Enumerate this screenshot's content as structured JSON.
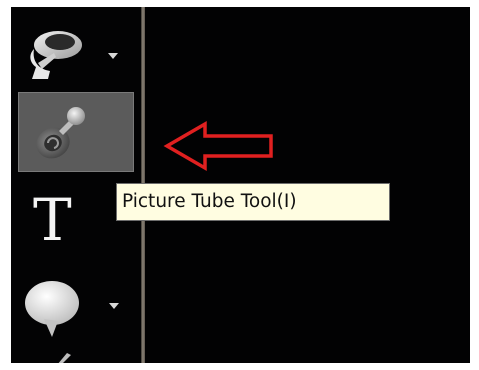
{
  "toolbar": {
    "tools": [
      {
        "name": "magic-fill",
        "icon": "magic-fill-icon",
        "has_dropdown": true
      },
      {
        "name": "picture-tube",
        "icon": "picture-tube-icon",
        "selected": true
      },
      {
        "name": "text",
        "icon": "text-icon",
        "glyph": "T"
      },
      {
        "name": "preset-shape",
        "icon": "speech-bubble-icon",
        "has_dropdown": true
      }
    ]
  },
  "tooltip": {
    "text": "Picture Tube Tool(I)"
  },
  "annotation": {
    "type": "arrow",
    "color": "#e02020"
  },
  "colors": {
    "background": "#020203",
    "selected_tool": "#5b5b5b",
    "tooltip_bg": "#fffde1"
  }
}
